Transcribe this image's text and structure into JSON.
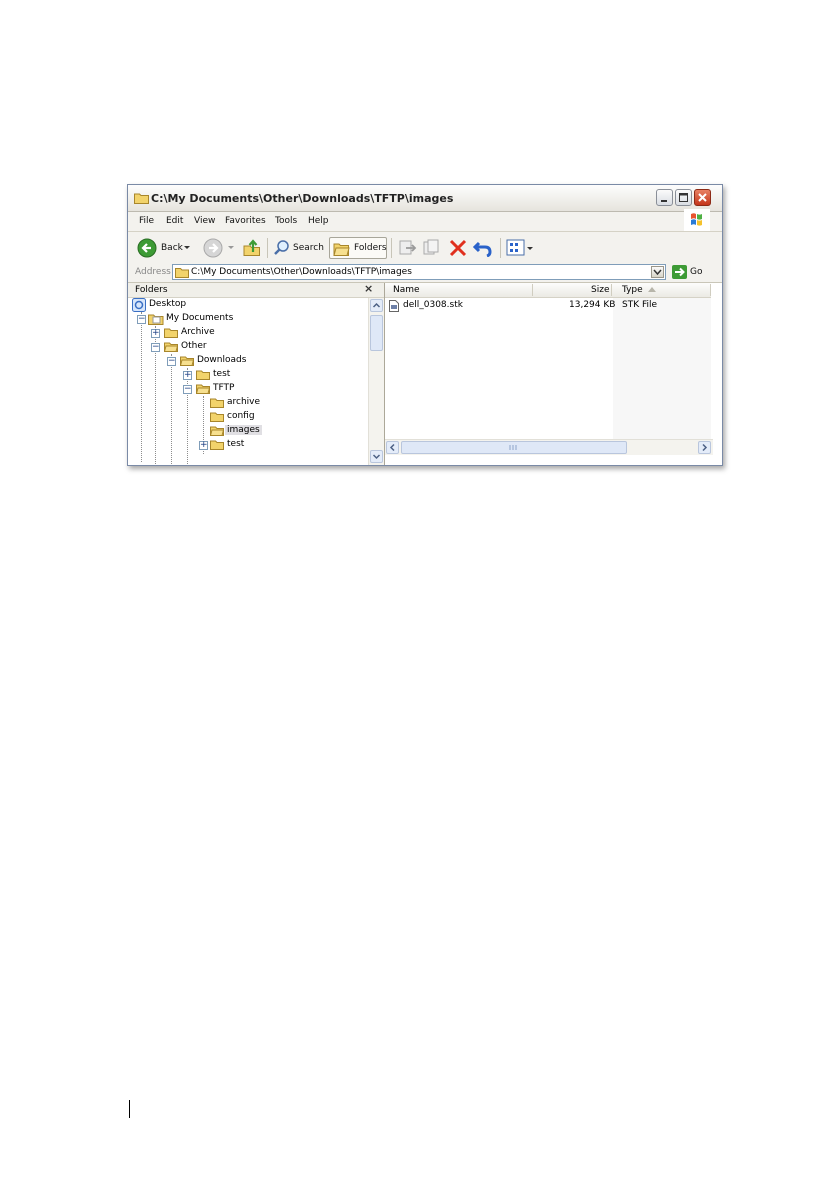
{
  "window": {
    "title": "C:\\My Documents\\Other\\Downloads\\TFTP\\images"
  },
  "menu": [
    "File",
    "Edit",
    "View",
    "Favorites",
    "Tools",
    "Help"
  ],
  "toolbar": {
    "back_label": "Back",
    "search_label": "Search",
    "folders_label": "Folders"
  },
  "address": {
    "label": "Address",
    "value": "C:\\My Documents\\Other\\Downloads\\TFTP\\images",
    "go_label": "Go"
  },
  "folders_pane": {
    "title": "Folders",
    "close_glyph": "×"
  },
  "tree": {
    "desktop": "Desktop",
    "my_documents": "My Documents",
    "archive": "Archive",
    "other": "Other",
    "downloads": "Downloads",
    "test": "test",
    "tftp": "TFTP",
    "tftp_archive": "archive",
    "config": "config",
    "images": "images",
    "tftp_test": "test"
  },
  "columns": {
    "name": "Name",
    "size": "Size",
    "type": "Type"
  },
  "files": [
    {
      "name": "dell_0308.stk",
      "size": "13,294 KB",
      "type": "STK File"
    }
  ],
  "colors": {
    "folder": "#f2d36b",
    "go_green": "#3d9b35",
    "delete_red": "#e0301e",
    "undo_blue": "#2a62c9"
  }
}
